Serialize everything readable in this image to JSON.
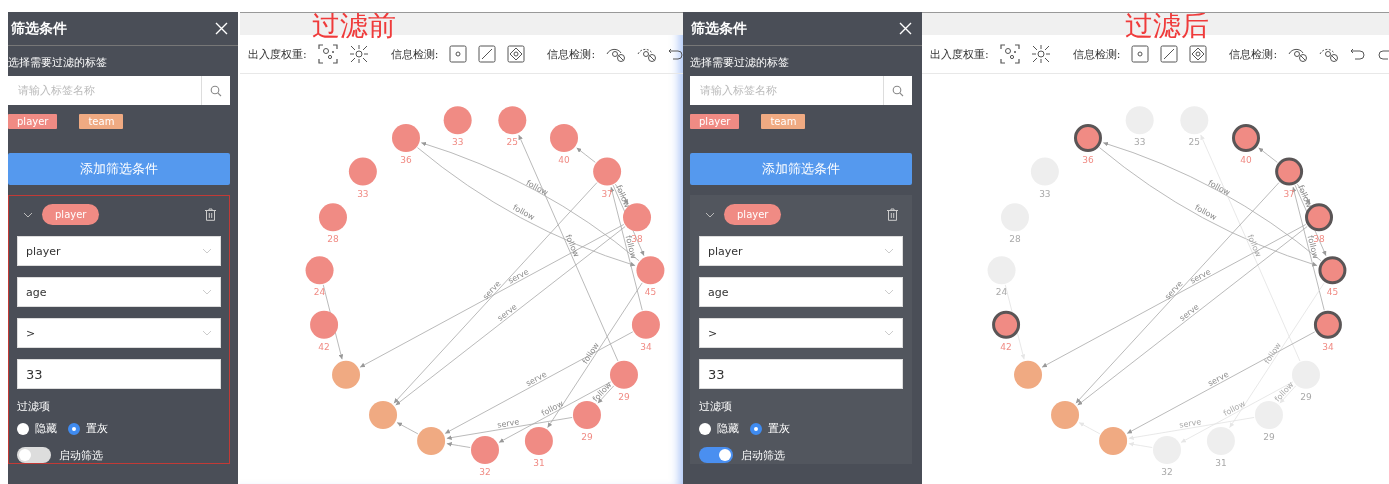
{
  "panels": [
    {
      "caption": "过滤前",
      "sidebar": {
        "title": "筛选条件",
        "tag_prompt": "选择需要过滤的标签",
        "search": {
          "placeholder": "请输入标签名称"
        },
        "tags": [
          {
            "label": "player",
            "color": "#f08b84"
          },
          {
            "label": "team",
            "color": "#f0aa82"
          }
        ],
        "add_button": "添加筛选条件",
        "condition": {
          "outlined": true,
          "expanded": true,
          "tag": {
            "label": "player",
            "color": "#f08b84"
          },
          "fields": [
            {
              "kind": "select",
              "value": "player"
            },
            {
              "kind": "select",
              "value": "age"
            },
            {
              "kind": "select",
              "value": ">"
            },
            {
              "kind": "input",
              "value": "33"
            }
          ],
          "filter_label": "过滤项",
          "options": [
            {
              "label": "隐藏",
              "selected": false
            },
            {
              "label": "置灰",
              "selected": true
            }
          ],
          "toggle": {
            "label": "启动筛选",
            "on": false
          }
        }
      },
      "toolbar": {
        "groups": [
          {
            "kind": "weight",
            "label": "出入度权重:"
          },
          {
            "kind": "shape",
            "label": "信息检测:"
          },
          {
            "kind": "visibility",
            "label": "信息检测:"
          }
        ]
      },
      "graph": {
        "nodes": [
          {
            "label": "33",
            "color": "#f08b84",
            "highlighted": false,
            "greyed": false
          },
          {
            "label": "25",
            "color": "#f08b84",
            "highlighted": false,
            "greyed": false
          },
          {
            "label": "40",
            "color": "#f08b84",
            "highlighted": false,
            "greyed": false
          },
          {
            "label": "37",
            "color": "#f08b84",
            "highlighted": false,
            "greyed": false
          },
          {
            "label": "38",
            "color": "#f08b84",
            "highlighted": false,
            "greyed": false
          },
          {
            "label": "45",
            "color": "#f08b84",
            "highlighted": false,
            "greyed": false
          },
          {
            "label": "34",
            "color": "#f08b84",
            "highlighted": false,
            "greyed": false
          },
          {
            "label": "29",
            "color": "#f08b84",
            "highlighted": false,
            "greyed": false
          },
          {
            "label": "29",
            "color": "#f08b84",
            "highlighted": false,
            "greyed": false
          },
          {
            "label": "31",
            "color": "#f08b84",
            "highlighted": false,
            "greyed": false
          },
          {
            "label": "32",
            "color": "#f08b84",
            "highlighted": false,
            "greyed": false
          },
          {
            "color": "#f0aa82",
            "highlighted": false
          },
          {
            "color": "#f0aa82",
            "highlighted": false
          },
          {
            "color": "#f0aa82",
            "highlighted": false
          },
          {
            "label": "42",
            "color": "#f08b84",
            "highlighted": false,
            "greyed": false
          },
          {
            "label": "24",
            "color": "#f08b84",
            "highlighted": false,
            "greyed": false
          },
          {
            "label": "28",
            "color": "#f08b84",
            "highlighted": false,
            "greyed": false
          },
          {
            "label": "33",
            "color": "#f08b84",
            "highlighted": false,
            "greyed": false
          },
          {
            "label": "36",
            "color": "#f08b84",
            "highlighted": false,
            "greyed": false
          }
        ],
        "edges": [
          {
            "label": "follow",
            "greyed": false
          },
          {
            "label": "follow",
            "greyed": false
          },
          {
            "label": "follow",
            "greyed": false
          },
          {
            "greyed": false
          },
          {
            "label": "follow",
            "greyed": false
          },
          {
            "label": "follow",
            "greyed": false
          },
          {
            "greyed": false
          },
          {
            "label": "serve",
            "greyed": false
          },
          {
            "label": "serve",
            "greyed": false
          },
          {
            "label": "serve",
            "greyed": false
          },
          {
            "label": "follow",
            "greyed": false
          },
          {
            "label": "serve",
            "greyed": false
          },
          {
            "label": "follow",
            "greyed": false
          },
          {
            "label": "serve",
            "greyed": false
          },
          {
            "label": "follow",
            "greyed": false
          },
          {
            "greyed": false
          },
          {
            "greyed": false
          },
          {
            "greyed": false
          }
        ]
      }
    },
    {
      "caption": "过滤后",
      "sidebar": {
        "title": "筛选条件",
        "tag_prompt": "选择需要过滤的标签",
        "search": {
          "placeholder": "请输入标签名称"
        },
        "tags": [
          {
            "label": "player",
            "color": "#f08b84"
          },
          {
            "label": "team",
            "color": "#f0aa82"
          }
        ],
        "add_button": "添加筛选条件",
        "condition": {
          "outlined": false,
          "expanded": true,
          "tag": {
            "label": "player",
            "color": "#f08b84"
          },
          "fields": [
            {
              "kind": "select",
              "value": "player"
            },
            {
              "kind": "select",
              "value": "age"
            },
            {
              "kind": "select",
              "value": ">"
            },
            {
              "kind": "input",
              "value": "33"
            }
          ],
          "filter_label": "过滤项",
          "options": [
            {
              "label": "隐藏",
              "selected": false
            },
            {
              "label": "置灰",
              "selected": true
            }
          ],
          "toggle": {
            "label": "启动筛选",
            "on": true
          }
        }
      },
      "toolbar": {
        "groups": [
          {
            "kind": "weight",
            "label": "出入度权重:"
          },
          {
            "kind": "shape",
            "label": "信息检测:"
          },
          {
            "kind": "visibility",
            "label": "信息检测:"
          }
        ]
      },
      "graph": {
        "nodes": [
          {
            "label": "33",
            "color": "#eeeeee",
            "highlighted": false,
            "greyed": true
          },
          {
            "label": "25",
            "color": "#eeeeee",
            "highlighted": false,
            "greyed": true
          },
          {
            "label": "40",
            "color": "#f08b84",
            "highlighted": true,
            "greyed": false
          },
          {
            "label": "37",
            "color": "#f08b84",
            "highlighted": true,
            "greyed": false
          },
          {
            "label": "38",
            "color": "#f08b84",
            "highlighted": true,
            "greyed": false
          },
          {
            "label": "45",
            "color": "#f08b84",
            "highlighted": true,
            "greyed": false
          },
          {
            "label": "34",
            "color": "#f08b84",
            "highlighted": true,
            "greyed": false
          },
          {
            "label": "29",
            "color": "#eeeeee",
            "highlighted": false,
            "greyed": true
          },
          {
            "label": "29",
            "color": "#eeeeee",
            "highlighted": false,
            "greyed": true
          },
          {
            "label": "31",
            "color": "#eeeeee",
            "highlighted": false,
            "greyed": true
          },
          {
            "label": "32",
            "color": "#eeeeee",
            "highlighted": false,
            "greyed": true
          },
          {
            "color": "#f0aa82",
            "highlighted": false
          },
          {
            "color": "#f0aa82",
            "highlighted": false
          },
          {
            "color": "#f0aa82",
            "highlighted": false
          },
          {
            "label": "42",
            "color": "#f08b84",
            "highlighted": true,
            "greyed": false
          },
          {
            "label": "24",
            "color": "#eeeeee",
            "highlighted": false,
            "greyed": true
          },
          {
            "label": "28",
            "color": "#eeeeee",
            "highlighted": false,
            "greyed": true
          },
          {
            "label": "33",
            "color": "#eeeeee",
            "highlighted": false,
            "greyed": true
          },
          {
            "label": "36",
            "color": "#f08b84",
            "highlighted": true,
            "greyed": false
          }
        ],
        "edges": [
          {
            "label": "follow",
            "greyed": false
          },
          {
            "label": "follow",
            "greyed": false
          },
          {
            "label": "follow",
            "greyed": true
          },
          {
            "greyed": false
          },
          {
            "label": "follow",
            "greyed": false
          },
          {
            "label": "follow",
            "greyed": false
          },
          {
            "greyed": false
          },
          {
            "label": "serve",
            "greyed": false
          },
          {
            "label": "serve",
            "greyed": false
          },
          {
            "label": "serve",
            "greyed": false
          },
          {
            "label": "follow",
            "greyed": true
          },
          {
            "label": "serve",
            "greyed": false
          },
          {
            "label": "follow",
            "greyed": true
          },
          {
            "label": "serve",
            "greyed": true
          },
          {
            "label": "follow",
            "greyed": true
          },
          {
            "greyed": true
          },
          {
            "greyed": true
          },
          {
            "greyed": true
          }
        ]
      }
    }
  ]
}
